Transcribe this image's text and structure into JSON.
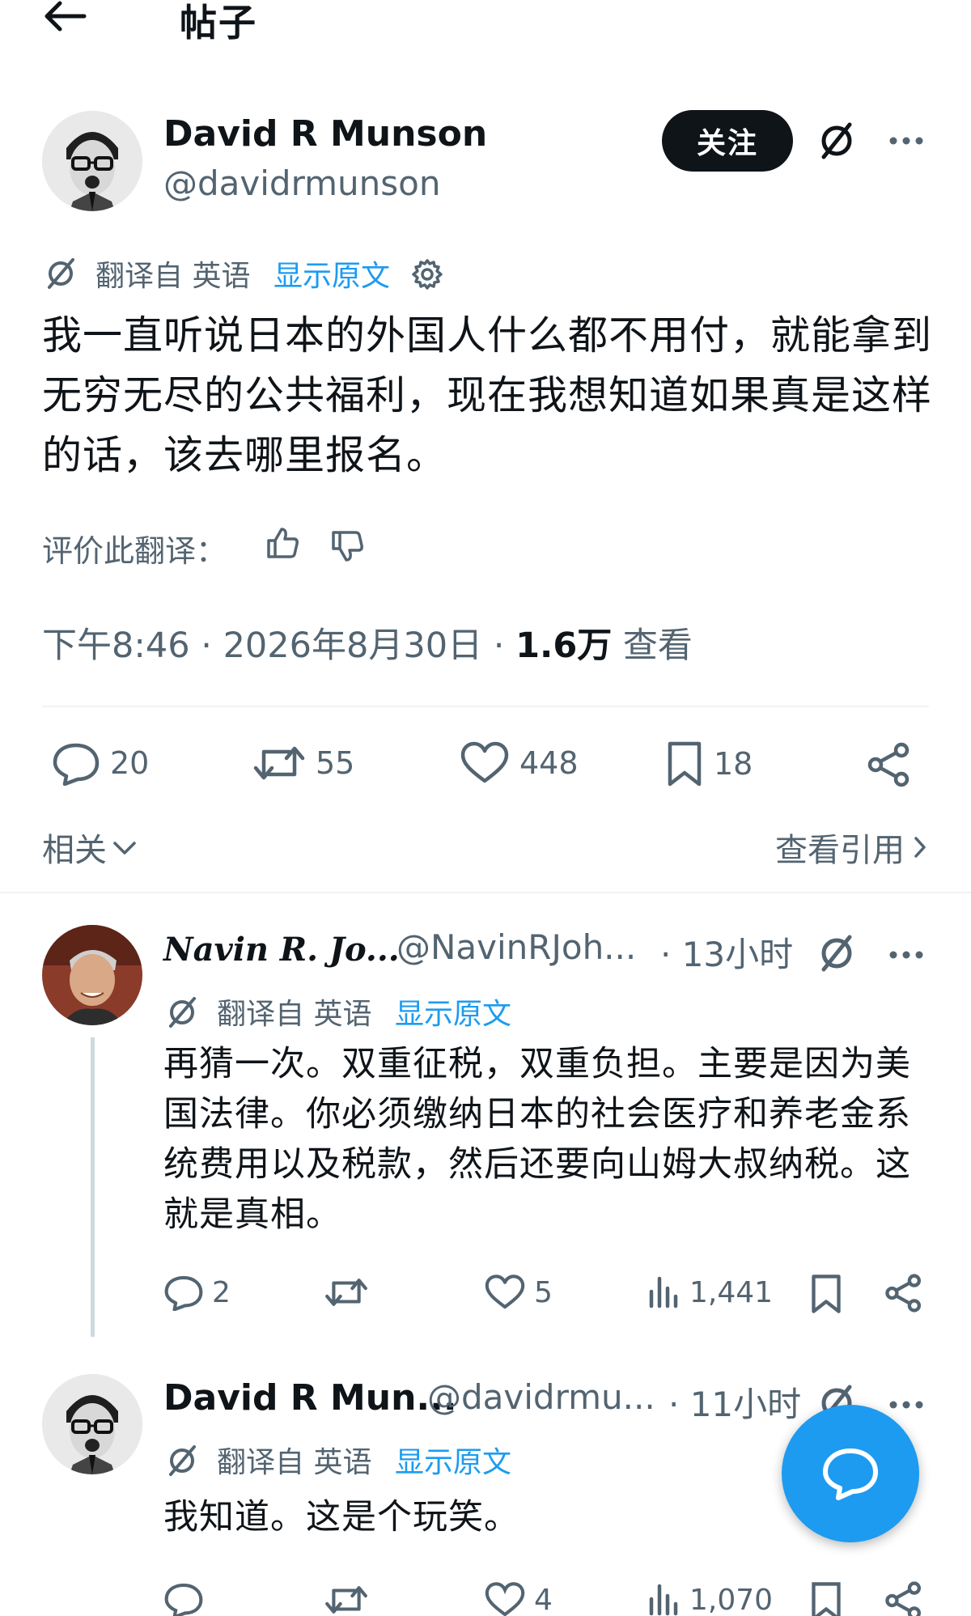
{
  "header": {
    "title": "帖子"
  },
  "post": {
    "author_name": "David R Munson",
    "author_handle": "@davidrmunson",
    "follow_label": "关注",
    "translated_from": "翻译自 英语",
    "show_original": "显示原文",
    "text": "我一直听说日本的外国人什么都不用付，就能拿到无穷无尽的公共福利，现在我想知道如果真是这样的话，该去哪里报名。",
    "rate_translation": "评价此翻译：",
    "time": "下午8:46 · 2026年8月30日 · ",
    "views_count": "1.6万",
    "views_label": " 查看",
    "stats": {
      "replies": "20",
      "reposts": "55",
      "likes": "448",
      "bookmarks": "18"
    },
    "related_label": "相关",
    "quotes_label": "查看引用"
  },
  "replies": [
    {
      "author_name": "Navin R. Jo...",
      "author_handle": "@NavinRJoh...",
      "time": "· 13小时",
      "translated_from": "翻译自 英语",
      "show_original": "显示原文",
      "text": "再猜一次。双重征税，双重负担。主要是因为美国法律。你必须缴纳日本的社会医疗和养老金系统费用以及税款，然后还要向山姆大叔纳税。这就是真相。",
      "stats": {
        "replies": "2",
        "reposts": "",
        "likes": "5",
        "views": "1,441"
      }
    },
    {
      "author_name": "David R Mun...",
      "author_handle": "@davidrmu...",
      "time": "· 11小时",
      "translated_from": "翻译自 英语",
      "show_original": "显示原文",
      "text": "我知道。这是个玩笑。",
      "stats": {
        "likes": "4",
        "views": "1,070"
      }
    }
  ],
  "colors": {
    "accent": "#1d9bf0",
    "text": "#0f1419",
    "muted": "#536471",
    "divider": "#eff3f4"
  }
}
